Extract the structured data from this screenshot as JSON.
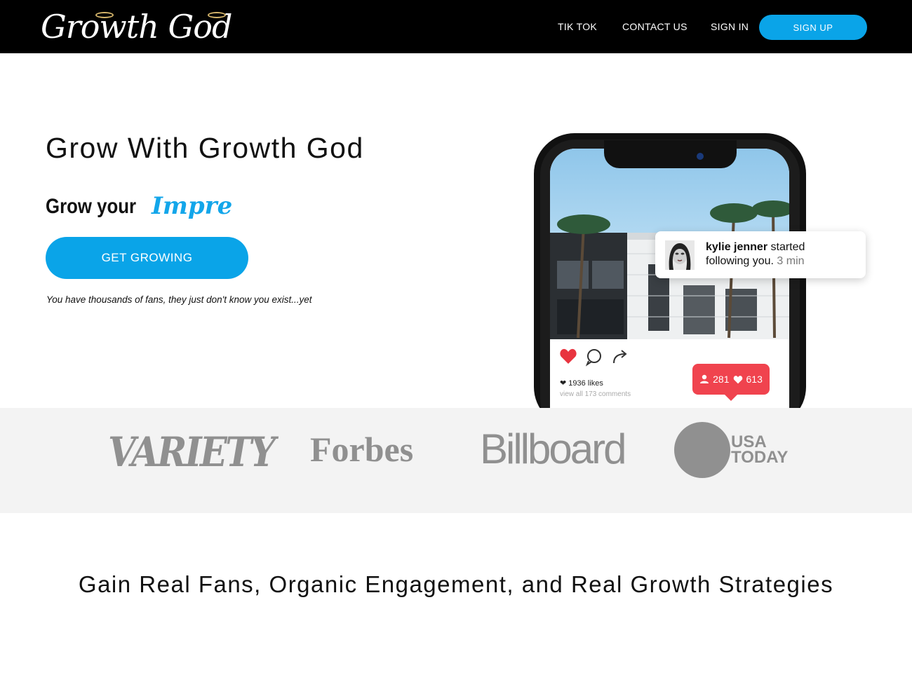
{
  "nav": {
    "logo_text": "Growth God",
    "links": [
      "TIK TOK",
      "CONTACT US",
      "SIGN IN"
    ],
    "signup_label": "SIGN UP"
  },
  "hero": {
    "title": "Grow With Growth God",
    "grow_prefix": "Grow your",
    "grow_word": "Impre",
    "cta_label": "GET GROWING",
    "tagline": "You have thousands of fans, they just don't know you exist...yet"
  },
  "phone": {
    "notification": {
      "name": "kylie jenner",
      "action_part1": "started",
      "action_part2": "following you.",
      "time": "3 min"
    },
    "likes": "1936 likes",
    "comments": "view all 173 comments",
    "stats": {
      "followers": "281",
      "hearts": "613"
    }
  },
  "press": {
    "logos": [
      "VARIETY",
      "Forbes",
      "Billboard",
      "USA",
      "TODAY"
    ]
  },
  "bottom": {
    "headline": "Gain Real Fans, Organic Engagement, and Real Growth Strategies"
  },
  "colors": {
    "accent": "#0aa4e8",
    "badge": "#f0434e",
    "press_gray": "#909090"
  }
}
